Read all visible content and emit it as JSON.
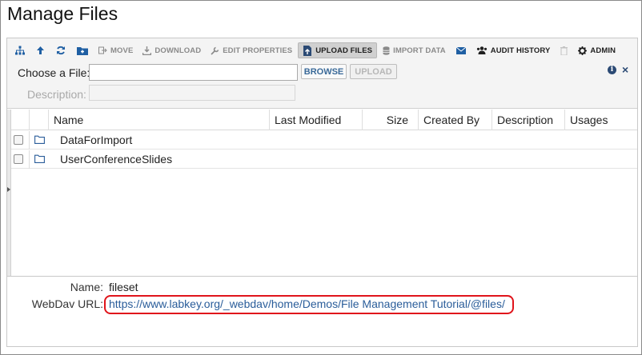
{
  "page": {
    "title": "Manage Files"
  },
  "toolbar": {
    "icons": [
      "sitemap-icon",
      "arrow-up-icon",
      "refresh-icon",
      "new-folder-icon"
    ],
    "move": "MOVE",
    "download": "DOWNLOAD",
    "edit_properties": "EDIT PROPERTIES",
    "upload_files": "UPLOAD FILES",
    "import_data": "IMPORT DATA",
    "email_icon": "envelope-icon",
    "audit_history": "AUDIT HISTORY",
    "delete_icon": "trash-icon",
    "admin": "ADMIN"
  },
  "upload": {
    "choose_label": "Choose a File:",
    "file_value": "",
    "description_label": "Description:",
    "description_value": "",
    "browse": "BROWSE",
    "upload": "UPLOAD"
  },
  "grid": {
    "columns": [
      "Name",
      "Last Modified",
      "Size",
      "Created By",
      "Description",
      "Usages"
    ],
    "rows": [
      {
        "name": "DataForImport",
        "last_modified": "",
        "size": "",
        "created_by": "",
        "description": "",
        "usages": ""
      },
      {
        "name": "UserConferenceSlides",
        "last_modified": "",
        "size": "",
        "created_by": "",
        "description": "",
        "usages": ""
      }
    ]
  },
  "details": {
    "name_label": "Name:",
    "name_value": "fileset",
    "webdav_label": "WebDav URL:",
    "webdav_value": "https://www.labkey.org/_webdav/home/Demos/File Management Tutorial/@files/"
  },
  "colors": {
    "accent": "#1f5fa3",
    "link": "#2a5d9a",
    "highlight": "#e0141b",
    "toolbar_bg": "#f4f4f4"
  }
}
